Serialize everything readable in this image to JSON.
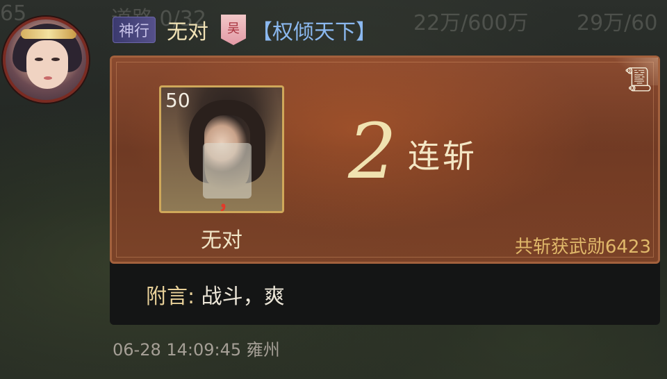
{
  "background": {
    "text_left": "65",
    "text_road": "道路 0/32",
    "text_mid": "22万/600万",
    "text_right": "29万/60"
  },
  "header": {
    "tag": "神行",
    "sender_name": "无对",
    "banner_char": "吴",
    "alliance": "【权倾天下】"
  },
  "report": {
    "general_level": "50",
    "general_name": "无对",
    "grade_mark": "，",
    "kill_count": "2",
    "kill_label": "连斩",
    "merit_text": "共斩获武勋6423",
    "scroll_icon": "scroll-icon"
  },
  "note": {
    "label": "附言:",
    "text": "战斗，爽"
  },
  "timestamp": "06-28 14:09:45 雍州",
  "colors": {
    "tag_bg": "#55508a",
    "sender": "#f2e3b6",
    "alliance": "#8bb8ef",
    "merit": "#e0b86a",
    "grade": "#e23a2a"
  }
}
